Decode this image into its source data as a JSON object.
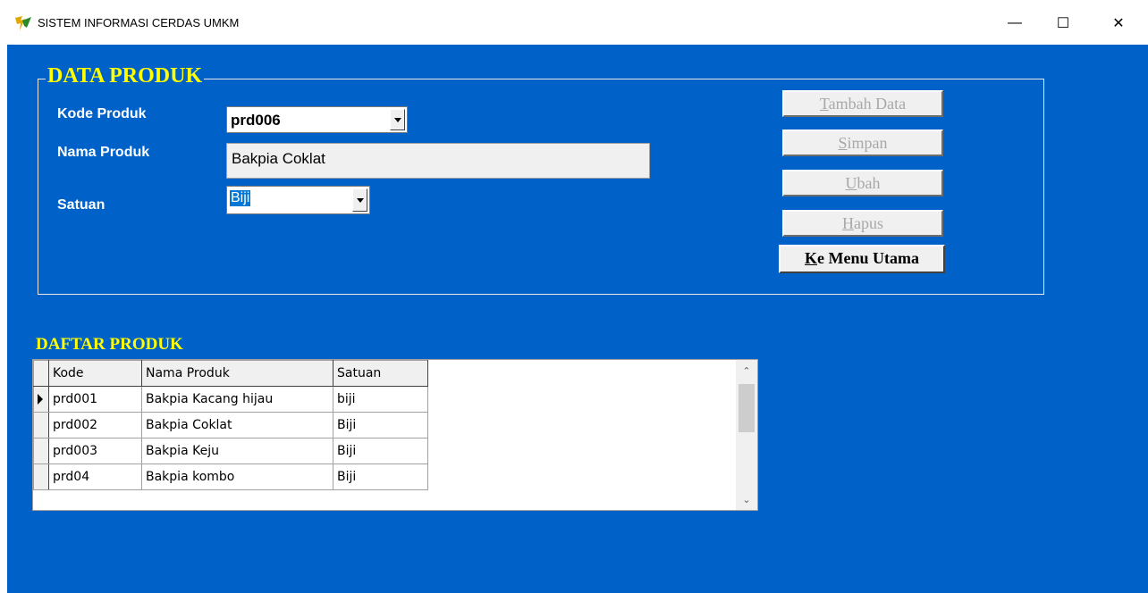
{
  "window": {
    "title": "SISTEM INFORMASI CERDAS UMKM",
    "minimize_symbol": "—",
    "maximize_symbol": "☐",
    "close_symbol": "✕"
  },
  "form": {
    "group_title": "DATA PRODUK",
    "kode_label": "Kode Produk",
    "kode_value": "prd006",
    "nama_label": "Nama Produk",
    "nama_value": "Bakpia Coklat",
    "satuan_label": "Satuan",
    "satuan_value": "Biji"
  },
  "buttons": {
    "tambah": {
      "accel": "T",
      "rest": "ambah Data"
    },
    "simpan": {
      "accel": "S",
      "rest": "impan"
    },
    "ubah": {
      "accel": "U",
      "rest": "bah"
    },
    "hapus": {
      "accel": "H",
      "rest": "apus"
    },
    "menu": {
      "accel": "K",
      "rest": "e Menu Utama"
    }
  },
  "list": {
    "title": "DAFTAR PRODUK",
    "columns": [
      "Kode",
      "Nama Produk",
      "Satuan"
    ],
    "rows": [
      {
        "kode": "prd001",
        "nama": "Bakpia Kacang hijau",
        "satuan": "biji"
      },
      {
        "kode": "prd002",
        "nama": "Bakpia Coklat",
        "satuan": "Biji"
      },
      {
        "kode": "prd003",
        "nama": "Bakpia Keju",
        "satuan": "Biji"
      },
      {
        "kode": "prd04",
        "nama": "Bakpia kombo",
        "satuan": "Biji"
      }
    ]
  },
  "colors": {
    "background": "#0062c9",
    "title_yellow": "#ffff00",
    "selection": "#0078d7"
  }
}
